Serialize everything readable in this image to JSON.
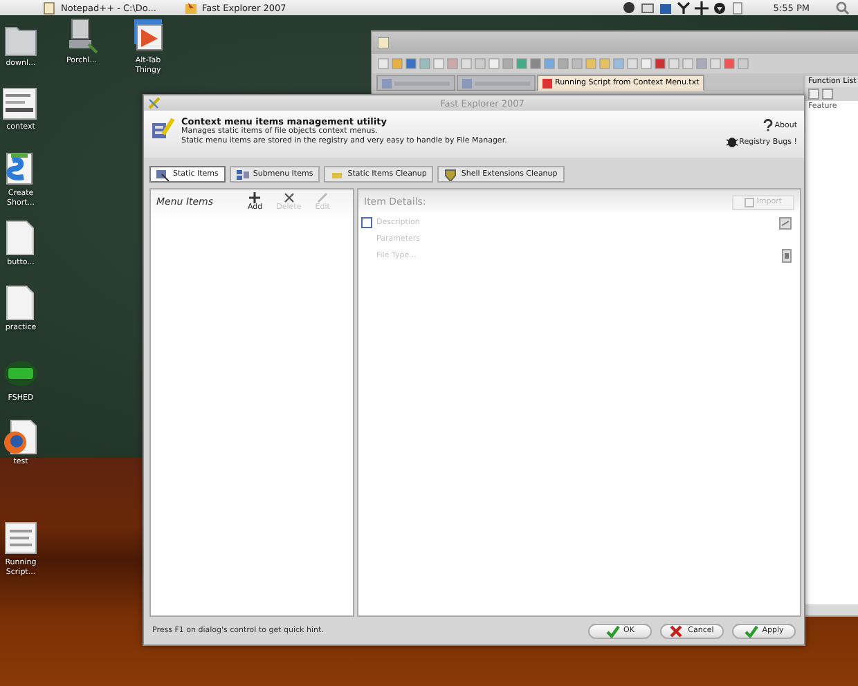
{
  "taskbar": {
    "items": [
      {
        "label": "Notepad++ - C:\\Do...",
        "kind": "notepad"
      },
      {
        "label": "Fast Explorer 2007",
        "kind": "explorer"
      }
    ],
    "clock": "5:55 PM"
  },
  "desktop_icons": [
    {
      "label": "downl...",
      "kind": "folder"
    },
    {
      "label": "Porchl...",
      "kind": "computer"
    },
    {
      "label": "Alt-Tab Thingy",
      "kind": "app"
    },
    {
      "label": "context",
      "kind": "screenshot"
    },
    {
      "label": "Create Short...",
      "kind": "script"
    },
    {
      "label": "butto...",
      "kind": "document"
    },
    {
      "label": "practice",
      "kind": "document"
    },
    {
      "label": "FSHED",
      "kind": "hex"
    },
    {
      "label": "test",
      "kind": "firefox"
    },
    {
      "label": "Running Script...",
      "kind": "text"
    }
  ],
  "background_window": {
    "tabs": [
      {
        "selected": false
      },
      {
        "selected": false
      },
      {
        "label": "Running Script from Context Menu.txt",
        "selected": true
      }
    ],
    "side_panel": {
      "title": "Function List",
      "text": "Feature"
    }
  },
  "dialog": {
    "title": "Fast Explorer 2007",
    "header": {
      "title": "Context menu items management utility",
      "lines": [
        "Manages static items of file objects context menus.",
        "Static menu items are stored in the registry and very easy to handle by File Manager."
      ],
      "links": [
        {
          "label": "About",
          "kind": "help"
        },
        {
          "label": "Registry Bugs !",
          "kind": "bug"
        }
      ]
    },
    "tabs": [
      {
        "label": "Static Items",
        "selected": true
      },
      {
        "label": "Submenu Items",
        "selected": false
      },
      {
        "label": "Static Items Cleanup",
        "selected": false
      },
      {
        "label": "Shell Extensions Cleanup",
        "selected": false
      }
    ],
    "left_panel": {
      "title": "Menu Items",
      "tools": [
        {
          "label": "Add",
          "kind": "add",
          "disabled": false
        },
        {
          "label": "Delete",
          "kind": "delete",
          "disabled": true
        },
        {
          "label": "Edit",
          "kind": "edit",
          "disabled": true
        }
      ]
    },
    "right_panel": {
      "title": "Item Details:",
      "button": "Import",
      "fields": [
        {
          "label": "Description",
          "kind": "checkbox",
          "checked": false
        },
        {
          "label": "Parameters",
          "kind": "text"
        },
        {
          "label": "File Type...",
          "kind": "browse"
        }
      ]
    },
    "status": "Press F1 on dialog's control to get quick hint.",
    "buttons": [
      {
        "label": "OK",
        "kind": "ok"
      },
      {
        "label": "Cancel",
        "kind": "cancel"
      },
      {
        "label": "Apply",
        "kind": "apply"
      }
    ]
  }
}
